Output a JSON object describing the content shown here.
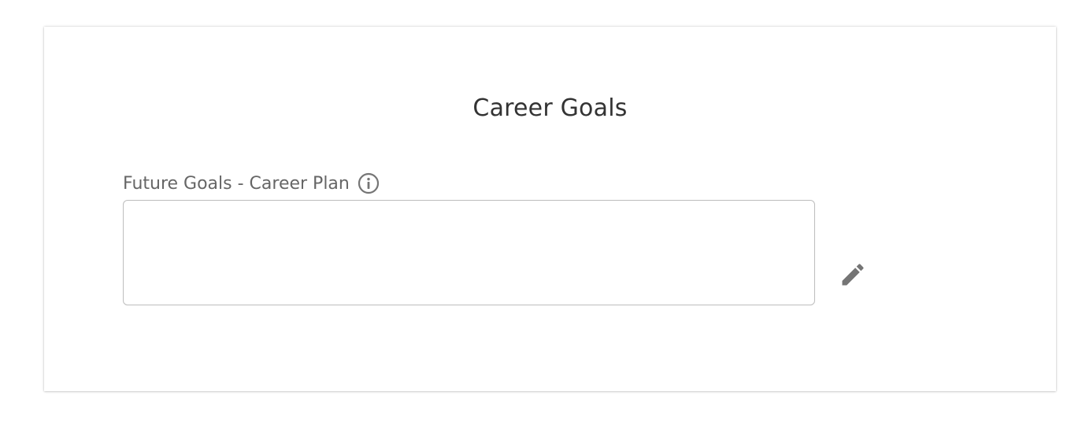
{
  "card": {
    "title": "Career Goals"
  },
  "field": {
    "label": "Future Goals - Career Plan",
    "value": "",
    "info_icon": "info-circle-icon",
    "edit_icon": "pencil-icon"
  },
  "colors": {
    "title_text": "#333333",
    "label_text": "#666666",
    "icon_gray": "#757575",
    "input_border": "#bdbdbd"
  }
}
